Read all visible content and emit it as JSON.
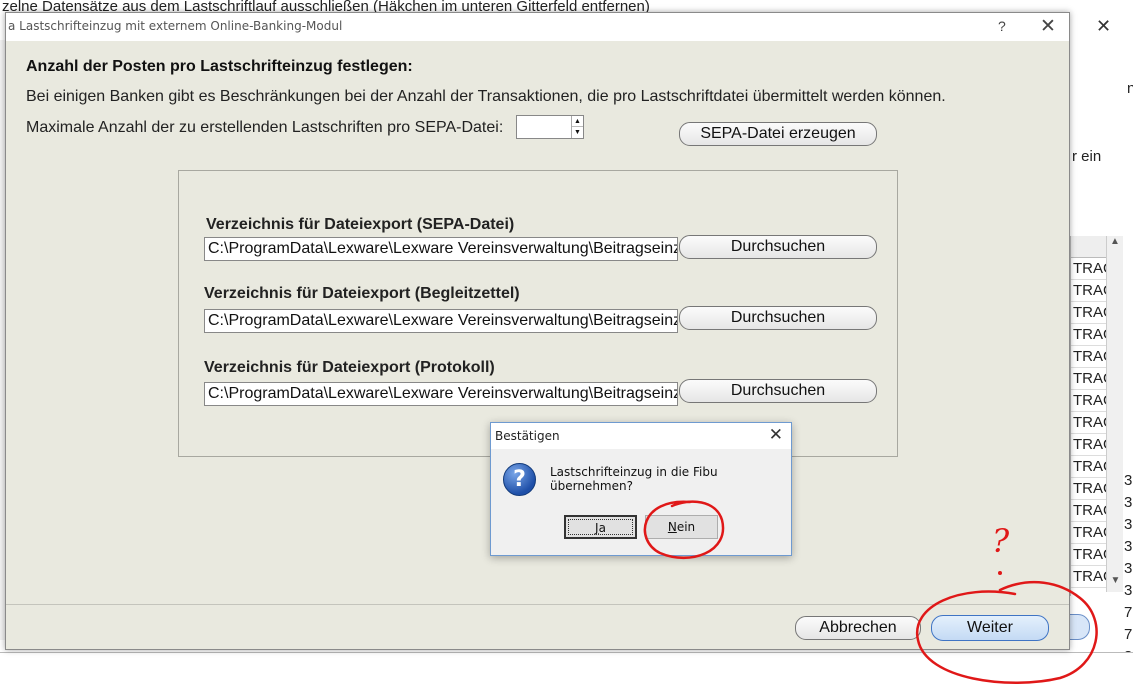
{
  "background": {
    "top_text": "zelne Datensätze aus dem Lastschriftlauf ausschließen (Häkchen im unteren Gitterfeld entfernen)",
    "right_text": "r ein",
    "right_text2": "n",
    "grid_rows": [
      "TRAG",
      "TRAG",
      "TRAG",
      "TRAG",
      "TRAG",
      "TRAG",
      "TRAG",
      "TRAG",
      "TRAG",
      "TRAG",
      "TRAG",
      "TRAG",
      "TRAG",
      "TRAG",
      "TRAG"
    ],
    "right_col": [
      "3",
      "3",
      "3",
      "3",
      "3",
      "3",
      "7",
      "7",
      "3",
      "3"
    ],
    "close_glyph": "✕"
  },
  "window": {
    "title": "a Lastschrifteinzug mit externem Online-Banking-Modul",
    "help": "?",
    "close": "✕"
  },
  "content": {
    "heading": "Anzahl der Posten pro Lastschrifteinzug festlegen:",
    "description": "Bei einigen Banken gibt es Beschränkungen bei der Anzahl der Transaktionen, die pro Lastschriftdatei übermittelt werden können.",
    "max_label": "Maximale Anzahl der zu erstellenden Lastschriften pro SEPA-Datei:",
    "max_value": "",
    "spin_up": "▲",
    "spin_down": "▼",
    "sepa_button": "SEPA-Datei erzeugen"
  },
  "directories": [
    {
      "label": "Verzeichnis für Dateiexport (SEPA-Datei)",
      "path": "C:\\ProgramData\\Lexware\\Lexware Vereinsverwaltung\\Beitragseinzu",
      "button": "Durchsuchen"
    },
    {
      "label": "Verzeichnis für Dateiexport (Begleitzettel)",
      "path": "C:\\ProgramData\\Lexware\\Lexware Vereinsverwaltung\\Beitragseinzu",
      "button": "Durchsuchen"
    },
    {
      "label": "Verzeichnis für Dateiexport (Protokoll)",
      "path": "C:\\ProgramData\\Lexware\\Lexware Vereinsverwaltung\\Beitragseinzu",
      "button": "Durchsuchen"
    }
  ],
  "footer": {
    "cancel": "Abbrechen",
    "next": "Weiter"
  },
  "confirm": {
    "title": "Bestätigen",
    "close": "✕",
    "icon": "?",
    "message": "Lastschrifteinzug in die Fibu übernehmen?",
    "yes_key": "J",
    "yes_rest": "a",
    "no_key": "N",
    "no_rest": "ein"
  },
  "annotation": {
    "question_mark": "?",
    "color": "#e01818"
  }
}
